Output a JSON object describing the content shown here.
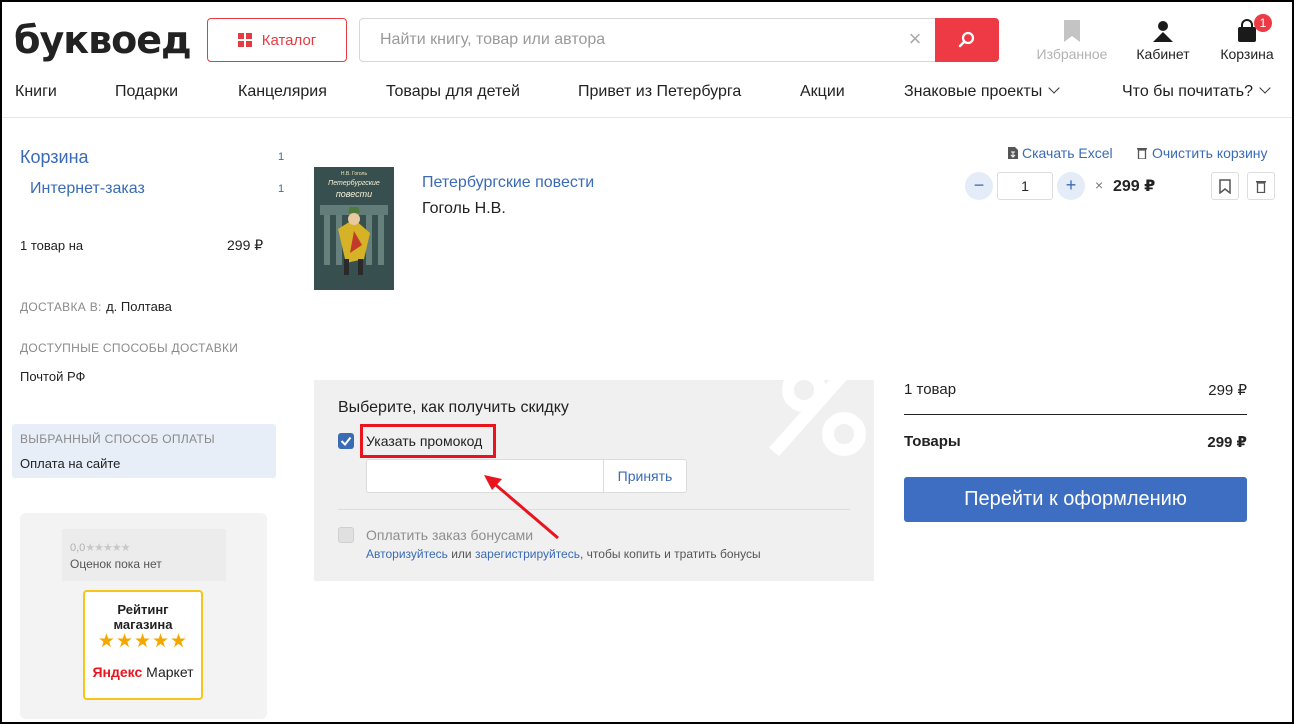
{
  "header": {
    "logo": "буквоед",
    "catalog_label": "Каталог",
    "search_placeholder": "Найти книгу, товар или автора",
    "favorites_label": "Избранное",
    "cabinet_label": "Кабинет",
    "cart_label": "Корзина",
    "cart_count": "1"
  },
  "nav": {
    "items": [
      "Книги",
      "Подарки",
      "Канцелярия",
      "Товары для детей",
      "Привет из Петербурга",
      "Акции",
      "Знаковые проекты",
      "Что бы почитать?"
    ]
  },
  "sidebar": {
    "cart_title": "Корзина",
    "cart_count": "1",
    "order_type": "Интернет-заказ",
    "order_count": "1",
    "items_summary": "1 товар на",
    "items_total": "299 ₽",
    "delivery_caption": "ДОСТАВКА В:",
    "delivery_city": "д. Полтава",
    "methods_caption": "ДОСТУПНЫЕ СПОСОБЫ ДОСТАВКИ",
    "method": "Почтой РФ",
    "payment_caption": "ВЫБРАННЫЙ СПОСОБ ОПЛАТЫ",
    "payment": "Оплата на сайте",
    "rating_score": "0,0",
    "rating_note": "Оценок пока нет",
    "badge_title_1": "Рейтинг",
    "badge_title_2": "магазина",
    "badge_brand_1": "Яндекс",
    "badge_brand_2": "Маркет"
  },
  "cart": {
    "download_excel": "Скачать Excel",
    "clear_cart": "Очистить корзину",
    "product": {
      "title": "Петербургские повести",
      "author": "Гоголь Н.В.",
      "qty": "1",
      "times": "×",
      "price": "299 ₽",
      "cover_author": "Н.В. Гоголь",
      "cover_title_1": "Петербургские",
      "cover_title_2": "повести"
    }
  },
  "discount": {
    "title": "Выберите, как получить скидку",
    "promo_label": "Указать промокод",
    "apply_label": "Принять",
    "bonus_label": "Оплатить заказ бонусами",
    "note_login": "Авторизуйтесь",
    "note_or": " или ",
    "note_register": "зарегистрируйтесь",
    "note_rest": ", чтобы копить и тратить бонусы"
  },
  "summary": {
    "row1_label": "1 товар",
    "row1_value": "299 ₽",
    "row2_label": "Товары",
    "row2_value": "299 ₽",
    "checkout_label": "Перейти к оформлению"
  },
  "colors": {
    "accent_red": "#ee3a45",
    "link_blue": "#3a6bb5",
    "checkout_blue": "#3d6ec2",
    "annotation_red": "#e8151f"
  }
}
